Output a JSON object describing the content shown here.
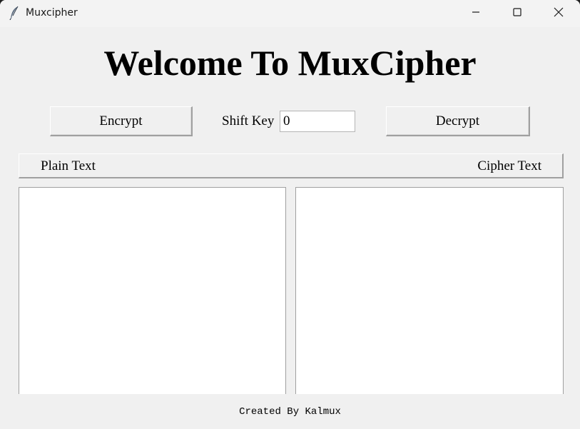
{
  "window": {
    "title": "Muxcipher",
    "icon": "feather-icon",
    "controls": {
      "minimize": "minimize-icon",
      "maximize": "maximize-icon",
      "close": "close-icon"
    }
  },
  "main": {
    "heading": "Welcome To MuxCipher",
    "encrypt_label": "Encrypt",
    "decrypt_label": "Decrypt",
    "shift_key_label": "Shift Key",
    "shift_key_value": "0",
    "plain_text_label": "Plain Text",
    "cipher_text_label": "Cipher Text",
    "plain_text_value": "",
    "cipher_text_value": ""
  },
  "footer": {
    "credit": "Created By Kalmux"
  },
  "colors": {
    "window_bg": "#f0f0f0",
    "titlebar_bg": "#f3f3f3",
    "text_area_bg": "#ffffff"
  }
}
